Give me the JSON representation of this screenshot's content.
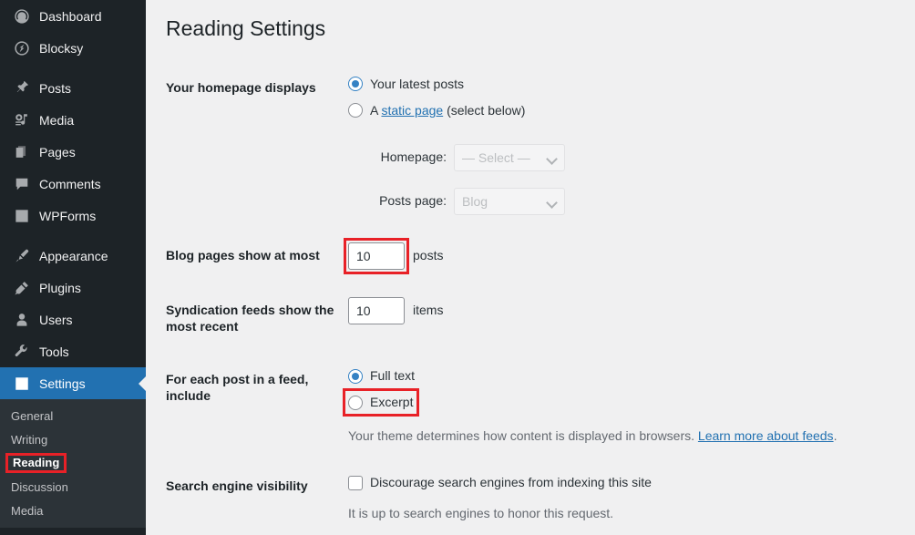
{
  "sidebar": {
    "items": [
      {
        "label": "Dashboard",
        "icon": "dashboard-icon",
        "name": "dashboard"
      },
      {
        "label": "Blocksy",
        "icon": "blocksy-icon",
        "name": "blocksy"
      },
      {
        "label": "Posts",
        "icon": "pin-icon",
        "name": "posts"
      },
      {
        "label": "Media",
        "icon": "media-icon",
        "name": "media"
      },
      {
        "label": "Pages",
        "icon": "pages-icon",
        "name": "pages"
      },
      {
        "label": "Comments",
        "icon": "comment-bubble-icon",
        "name": "comments"
      },
      {
        "label": "WPForms",
        "icon": "wpforms-icon",
        "name": "wpforms"
      },
      {
        "label": "Appearance",
        "icon": "paintbrush-icon",
        "name": "appearance"
      },
      {
        "label": "Plugins",
        "icon": "plug-icon",
        "name": "plugins"
      },
      {
        "label": "Users",
        "icon": "user-icon",
        "name": "users"
      },
      {
        "label": "Tools",
        "icon": "wrench-icon",
        "name": "tools"
      },
      {
        "label": "Settings",
        "icon": "sliders-icon",
        "name": "settings",
        "current": true
      }
    ],
    "submenu": [
      {
        "label": "General",
        "name": "general"
      },
      {
        "label": "Writing",
        "name": "writing"
      },
      {
        "label": "Reading",
        "name": "reading",
        "current": true,
        "highlighted": true
      },
      {
        "label": "Discussion",
        "name": "discussion"
      },
      {
        "label": "Media",
        "name": "media"
      }
    ]
  },
  "page": {
    "title": "Reading Settings"
  },
  "homepage_displays": {
    "label": "Your homepage displays",
    "options": [
      {
        "label": "Your latest posts",
        "selected": true
      },
      {
        "label_prefix": "A ",
        "link": "static page",
        "label_suffix": " (select below)",
        "selected": false
      }
    ],
    "homepage_select": {
      "label": "Homepage:",
      "value": "— Select —",
      "options": [
        "— Select —"
      ],
      "disabled": true
    },
    "posts_page_select": {
      "label": "Posts page:",
      "value": "Blog",
      "options": [
        "Blog"
      ],
      "disabled": true
    }
  },
  "blog_pages": {
    "label": "Blog pages show at most",
    "value": "10",
    "unit": "posts",
    "highlighted": true
  },
  "syndication_feeds": {
    "label": "Syndication feeds show the most recent",
    "value": "10",
    "unit": "items",
    "highlighted": false
  },
  "feed_include": {
    "label": "For each post in a feed, include",
    "options": [
      {
        "label": "Full text",
        "selected": true,
        "highlighted": false
      },
      {
        "label": "Excerpt",
        "selected": false,
        "highlighted": true
      }
    ],
    "description_prefix": "Your theme determines how content is displayed in browsers. ",
    "description_link": "Learn more about feeds",
    "description_suffix": "."
  },
  "search_visibility": {
    "label": "Search engine visibility",
    "checkbox_label": "Discourage search engines from indexing this site",
    "checked": false,
    "description": "It is up to search engines to honor this request."
  },
  "colors": {
    "sidebar_bg": "#1d2327",
    "submenu_bg": "#2c3338",
    "accent": "#2271b1",
    "link": "#2271b1",
    "highlight": "#e82127",
    "content_bg": "#f0f0f1"
  }
}
